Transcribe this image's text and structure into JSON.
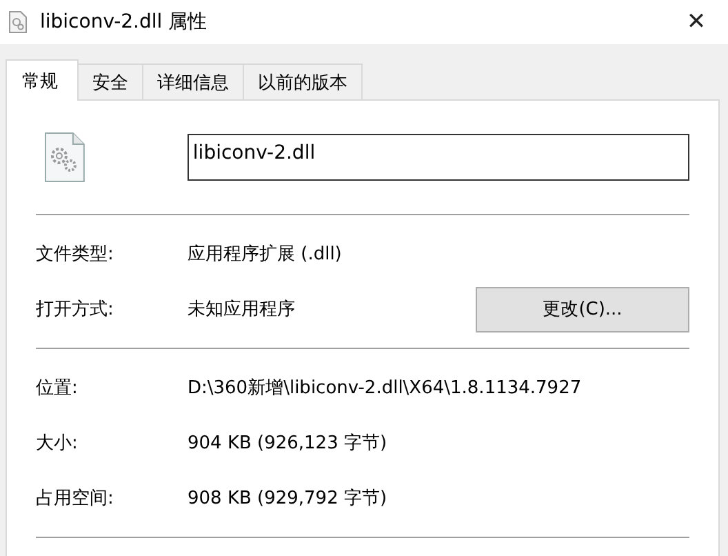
{
  "window": {
    "title": "libiconv-2.dll 属性",
    "close": "✕"
  },
  "tabs": [
    {
      "label": "常规",
      "selected": true
    },
    {
      "label": "安全",
      "selected": false
    },
    {
      "label": "详细信息",
      "selected": false
    },
    {
      "label": "以前的版本",
      "selected": false
    }
  ],
  "file_name": {
    "value": "libiconv-2.dll"
  },
  "sections": [
    [
      {
        "label": "文件类型:",
        "value": "应用程序扩展 (.dll)"
      },
      {
        "label": "打开方式:",
        "value": "未知应用程序",
        "button": "更改(C)..."
      }
    ],
    [
      {
        "label": "位置:",
        "value": "D:\\360新增\\libiconv-2.dll\\X64\\1.8.1134.7927"
      },
      {
        "label": "大小:",
        "value": "904 KB (926,123 字节)"
      },
      {
        "label": "占用空间:",
        "value": "908 KB (929,792 字节)"
      }
    ]
  ]
}
